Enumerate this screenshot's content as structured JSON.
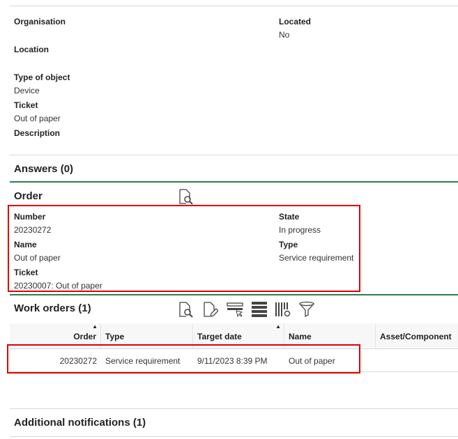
{
  "details": {
    "organisation_label": "Organisation",
    "located_label": "Located",
    "located_value": "No",
    "location_label": "Location",
    "type_label": "Type of object",
    "type_value": "Device",
    "ticket_label": "Ticket",
    "ticket_value": "Out of paper",
    "description_label": "Description"
  },
  "answers": {
    "title": "Answers (0)"
  },
  "order": {
    "title": "Order",
    "number_label": "Number",
    "number_value": "20230272",
    "state_label": "State",
    "state_value": "In progress",
    "name_label": "Name",
    "name_value": "Out of paper",
    "type_label": "Type",
    "type_value": "Service requirement",
    "ticket_label": "Ticket",
    "ticket_value": "20230007: Out of paper"
  },
  "work_orders": {
    "title": "Work orders (1)",
    "toolbar_icons": [
      "preview-icon",
      "edit-icon",
      "select-icon",
      "list-icon",
      "column-settings-icon",
      "filter-icon"
    ],
    "columns": [
      "Order",
      "Type",
      "Target date",
      "Name",
      "Asset/Component"
    ],
    "rows": [
      {
        "order": "20230272",
        "type": "Service requirement",
        "target_date": "9/11/2023 8:39 PM",
        "name": "Out of paper",
        "asset": ""
      }
    ]
  },
  "notifications": {
    "title": "Additional notifications (1)"
  },
  "colors": {
    "highlight": "#e00000",
    "divider": "#2e7d4f"
  }
}
